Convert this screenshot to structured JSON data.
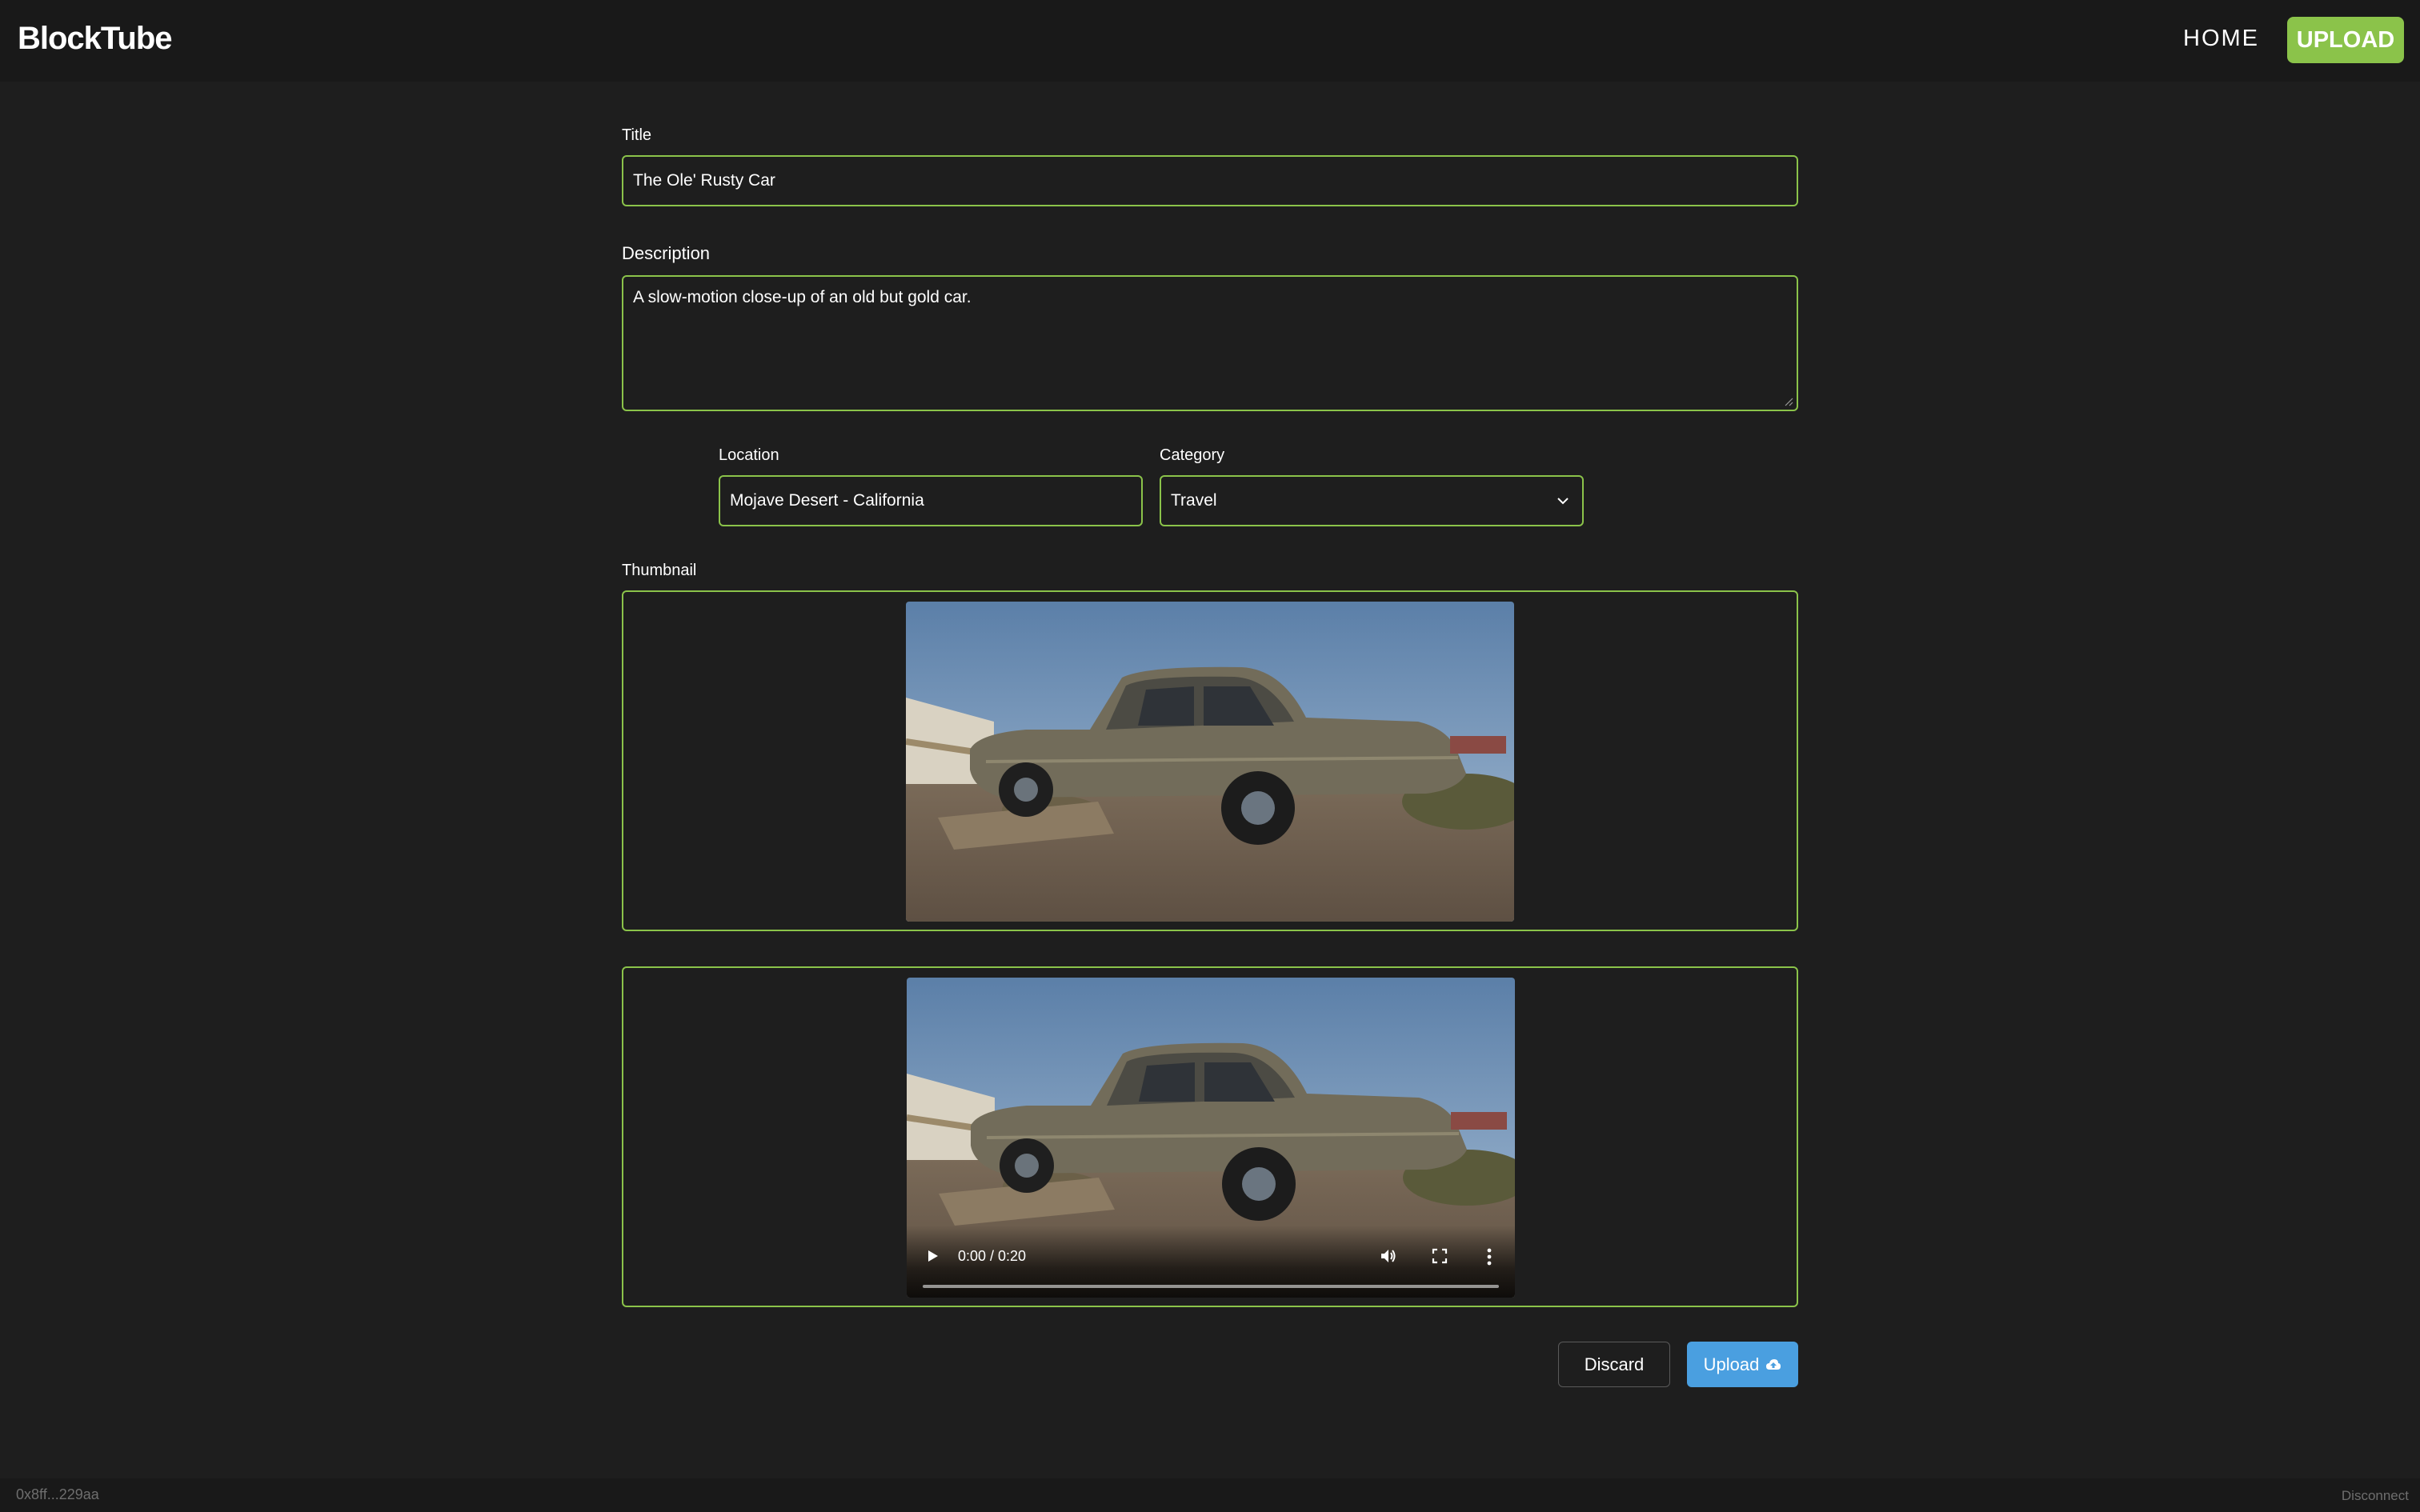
{
  "app": {
    "brand": "BlockTube"
  },
  "nav": {
    "home_label": "HOME",
    "upload_label": "UPLOAD"
  },
  "form": {
    "title": {
      "label": "Title",
      "value": "The Ole' Rusty Car"
    },
    "description": {
      "label": "Description",
      "value": "A slow-motion close-up of an old but gold car."
    },
    "location": {
      "label": "Location",
      "value": "Mojave Desert - California"
    },
    "category": {
      "label": "Category",
      "selected": "Travel"
    },
    "thumbnail": {
      "label": "Thumbnail"
    }
  },
  "video": {
    "time_display": "0:00 / 0:20",
    "progress": 0
  },
  "actions": {
    "discard_label": "Discard",
    "upload_label": "Upload"
  },
  "footer": {
    "wallet": "0x8ff...229aa",
    "disconnect_label": "Disconnect"
  },
  "colors": {
    "background": "#1e1e1e",
    "header": "#191919",
    "accent": "#8bc34a",
    "upload_button": "#4a9fe0",
    "muted_text": "#6e6e6e"
  },
  "icons": {
    "play": "play-icon",
    "volume": "volume-icon",
    "fullscreen": "fullscreen-icon",
    "more": "more-vertical-icon",
    "upload": "cloud-upload-icon",
    "dropdown": "chevron-down-icon"
  }
}
